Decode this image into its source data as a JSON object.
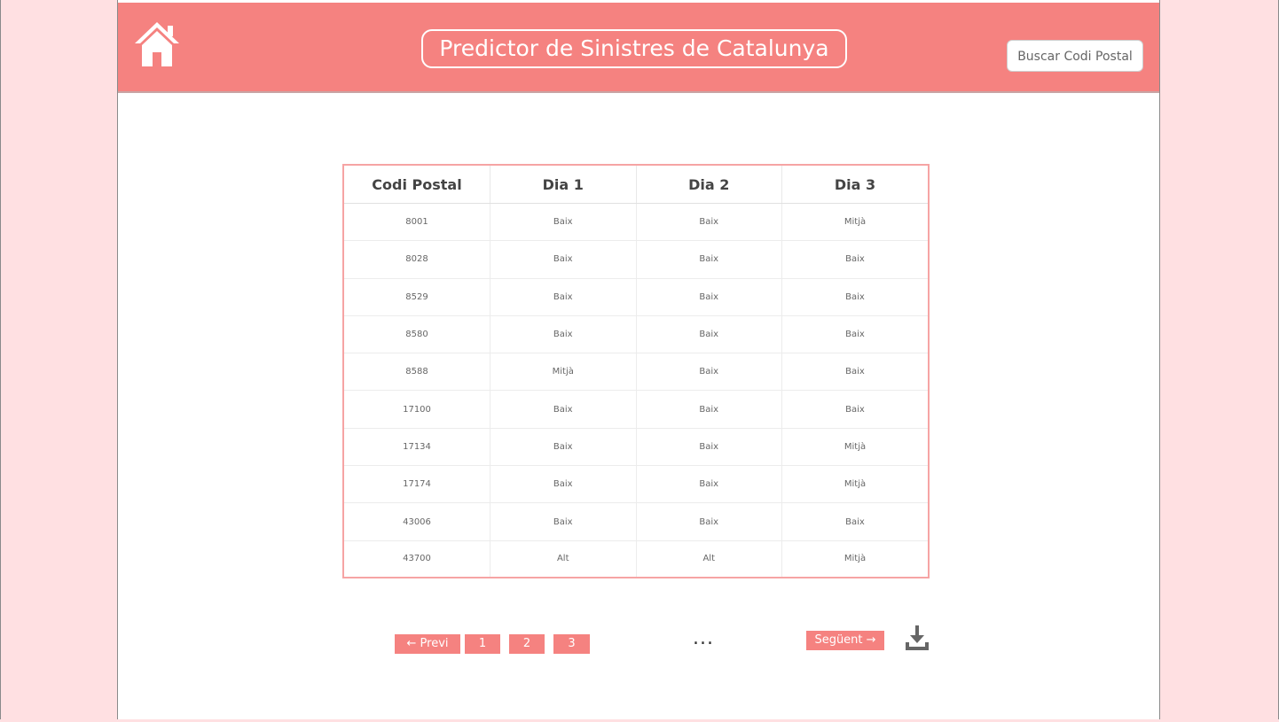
{
  "header": {
    "title": "Predictor de Sinistres de Catalunya",
    "search_label": "Buscar Codi Postal"
  },
  "table": {
    "columns": [
      "Codi Postal",
      "Dia 1",
      "Dia 2",
      "Dia 3"
    ],
    "rows": [
      [
        "8001",
        "Baix",
        "Baix",
        "Mitjà"
      ],
      [
        "8028",
        "Baix",
        "Baix",
        "Baix"
      ],
      [
        "8529",
        "Baix",
        "Baix",
        "Baix"
      ],
      [
        "8580",
        "Baix",
        "Baix",
        "Baix"
      ],
      [
        "8588",
        "Mitjà",
        "Baix",
        "Baix"
      ],
      [
        "17100",
        "Baix",
        "Baix",
        "Baix"
      ],
      [
        "17134",
        "Baix",
        "Baix",
        "Mitjà"
      ],
      [
        "17174",
        "Baix",
        "Baix",
        "Mitjà"
      ],
      [
        "43006",
        "Baix",
        "Baix",
        "Baix"
      ],
      [
        "43700",
        "Alt",
        "Alt",
        "Mitjà"
      ]
    ]
  },
  "pagination": {
    "prev_label": "← Previ",
    "pages": [
      "1",
      "2",
      "3"
    ],
    "ellipsis": "...",
    "next_label": "Següent →"
  },
  "icons": {
    "home": "home-icon",
    "download": "download-icon"
  },
  "colors": {
    "accent": "#f58280",
    "background": "#ffe0e2",
    "table_border": "#f6a4a4"
  }
}
